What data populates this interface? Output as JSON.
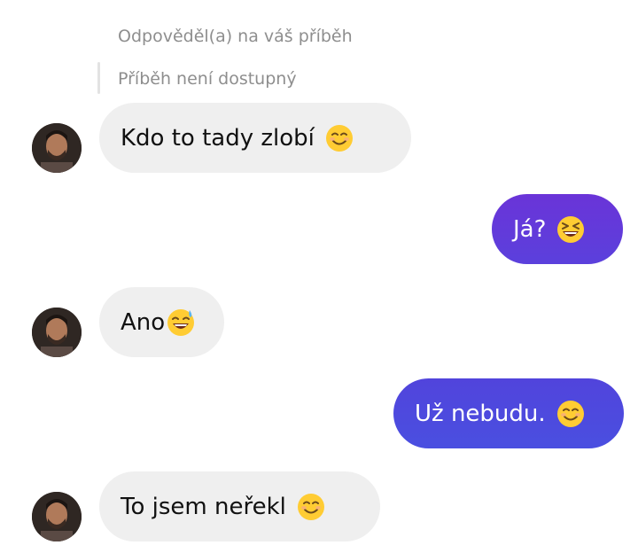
{
  "story": {
    "reply_label": "Odpověděl(a) na váš příběh",
    "unavailable_label": "Příběh není dostupný"
  },
  "messages": [
    {
      "direction": "incoming",
      "text": "Kdo to tady zlobí",
      "emoji": "smiling-face-icon"
    },
    {
      "direction": "outgoing",
      "text": "Já?",
      "emoji": "grinning-squinting-face-icon"
    },
    {
      "direction": "incoming",
      "text": "Ano",
      "emoji": "grinning-face-with-sweat-icon"
    },
    {
      "direction": "outgoing",
      "text": "Už nebudu.",
      "emoji": "smiling-face-icon"
    },
    {
      "direction": "incoming",
      "text": "To jsem neřekl",
      "emoji": "smiling-face-icon"
    }
  ],
  "colors": {
    "incoming_bubble": "#efefef",
    "outgoing_gradient_top": "#6a34d8",
    "outgoing_gradient_bottom": "#4a4fe0",
    "muted_text": "#8e8e8e"
  }
}
